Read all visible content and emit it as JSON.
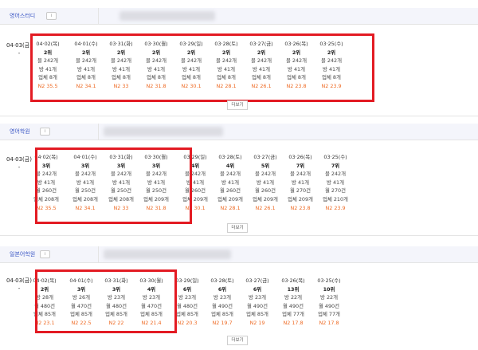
{
  "sections": [
    {
      "keyword": "영어스터디",
      "today_date": "04·03(금)",
      "today_value": "-",
      "more_label": "더보기",
      "columns": [
        {
          "date": "04·02(목)",
          "rank": "2위",
          "lines": [
            "블 242개",
            "방 41개",
            "업체 8개"
          ],
          "n2": "N2 35.5"
        },
        {
          "date": "04·01(수)",
          "rank": "2위",
          "lines": [
            "블 242개",
            "방 41개",
            "업체 8개"
          ],
          "n2": "N2 34.1"
        },
        {
          "date": "03·31(화)",
          "rank": "2위",
          "lines": [
            "블 242개",
            "방 41개",
            "업체 8개"
          ],
          "n2": "N2 33"
        },
        {
          "date": "03·30(월)",
          "rank": "2위",
          "lines": [
            "블 242개",
            "방 41개",
            "업체 8개"
          ],
          "n2": "N2 31.8"
        },
        {
          "date": "03·29(일)",
          "rank": "2위",
          "lines": [
            "블 242개",
            "방 41개",
            "업체 8개"
          ],
          "n2": "N2 30.1"
        },
        {
          "date": "03·28(토)",
          "rank": "2위",
          "lines": [
            "블 242개",
            "방 41개",
            "업체 8개"
          ],
          "n2": "N2 28.1"
        },
        {
          "date": "03·27(금)",
          "rank": "2위",
          "lines": [
            "블 242개",
            "방 41개",
            "업체 8개"
          ],
          "n2": "N2 26.1"
        },
        {
          "date": "03·26(목)",
          "rank": "2위",
          "lines": [
            "블 242개",
            "방 41개",
            "업체 8개"
          ],
          "n2": "N2 23.8"
        },
        {
          "date": "03·25(수)",
          "rank": "2위",
          "lines": [
            "블 242개",
            "방 41개",
            "업체 8개"
          ],
          "n2": "N2 23.9"
        }
      ]
    },
    {
      "keyword": "영어학원",
      "today_date": "04·03(금)",
      "today_value": "-",
      "more_label": "더보기",
      "columns": [
        {
          "date": "04·02(목)",
          "rank": "3위",
          "lines": [
            "블 242개",
            "방 41개",
            "월 260건",
            "업체 208개"
          ],
          "n2": "N2 35.5"
        },
        {
          "date": "04·01(수)",
          "rank": "3위",
          "lines": [
            "블 242개",
            "방 41개",
            "월 250건",
            "업체 208개"
          ],
          "n2": "N2 34.1"
        },
        {
          "date": "03·31(화)",
          "rank": "3위",
          "lines": [
            "블 242개",
            "방 41개",
            "월 250건",
            "업체 208개"
          ],
          "n2": "N2 33"
        },
        {
          "date": "03·30(월)",
          "rank": "3위",
          "lines": [
            "블 242개",
            "방 41개",
            "월 250건",
            "업체 209개"
          ],
          "n2": "N2 31.8"
        },
        {
          "date": "03·29(일)",
          "rank": "4위",
          "lines": [
            "블 242개",
            "방 41개",
            "월 260건",
            "업체 209개"
          ],
          "n2": "N2 30.1"
        },
        {
          "date": "03·28(토)",
          "rank": "4위",
          "lines": [
            "블 242개",
            "방 41개",
            "월 260건",
            "업체 209개"
          ],
          "n2": "N2 28.1"
        },
        {
          "date": "03·27(금)",
          "rank": "5위",
          "lines": [
            "블 242개",
            "방 41개",
            "월 260건",
            "업체 209개"
          ],
          "n2": "N2 26.1"
        },
        {
          "date": "03·26(목)",
          "rank": "7위",
          "lines": [
            "블 242개",
            "방 41개",
            "월 270건",
            "업체 209개"
          ],
          "n2": "N2 23.8"
        },
        {
          "date": "03·25(수)",
          "rank": "7위",
          "lines": [
            "블 242개",
            "방 41개",
            "월 270건",
            "업체 210개"
          ],
          "n2": "N2 23.9"
        }
      ]
    },
    {
      "keyword": "일본어학원",
      "today_date": "04·03(금)",
      "today_value": "-",
      "more_label": "더보기",
      "columns": [
        {
          "date": "04·02(목)",
          "rank": "2위",
          "lines": [
            "방 28개",
            "월 480건",
            "업체 85개"
          ],
          "n2": "N2 23.1"
        },
        {
          "date": "04·01(수)",
          "rank": "3위",
          "lines": [
            "방 26개",
            "월 470건",
            "업체 85개"
          ],
          "n2": "N2 22.5"
        },
        {
          "date": "03·31(화)",
          "rank": "3위",
          "lines": [
            "방 23개",
            "월 480건",
            "업체 85개"
          ],
          "n2": "N2 22"
        },
        {
          "date": "03·30(월)",
          "rank": "4위",
          "lines": [
            "방 23개",
            "월 470건",
            "업체 85개"
          ],
          "n2": "N2 21.4"
        },
        {
          "date": "03·29(일)",
          "rank": "6위",
          "lines": [
            "방 23개",
            "월 480건",
            "업체 85개"
          ],
          "n2": "N2 20.3"
        },
        {
          "date": "03·28(토)",
          "rank": "6위",
          "lines": [
            "방 23개",
            "월 490건",
            "업체 85개"
          ],
          "n2": "N2 19.7"
        },
        {
          "date": "03·27(금)",
          "rank": "6위",
          "lines": [
            "방 23개",
            "월 490건",
            "업체 85개"
          ],
          "n2": "N2 19"
        },
        {
          "date": "03·26(목)",
          "rank": "13위",
          "lines": [
            "방 22개",
            "월 490건",
            "업체 77개"
          ],
          "n2": "N2 17.8"
        },
        {
          "date": "03·25(수)",
          "rank": "10위",
          "lines": [
            "방 22개",
            "월 490건",
            "업체 77개"
          ],
          "n2": "N2 17.8"
        }
      ]
    }
  ],
  "colors": {
    "accent": "#3a56c5",
    "n2": "#ee6a24",
    "highlight": "#e31b23",
    "header_bg": "#f4f5fb"
  }
}
